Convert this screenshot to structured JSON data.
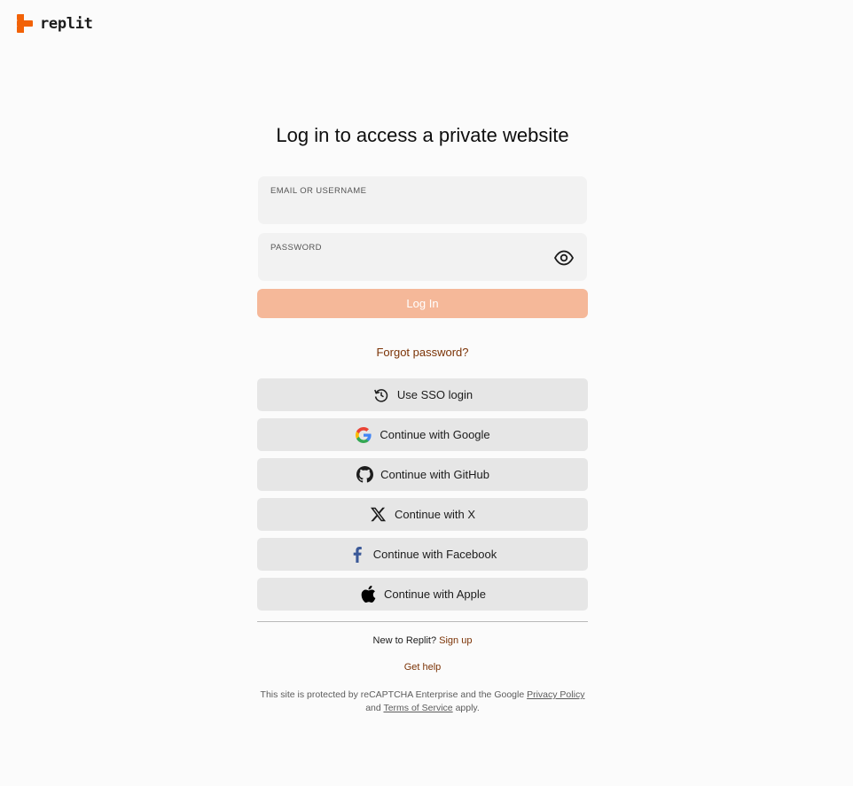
{
  "brand": {
    "wordmark": "replit",
    "color": "#f26207"
  },
  "page": {
    "title": "Log in to access a private website"
  },
  "form": {
    "username_label": "EMAIL OR USERNAME",
    "username_value": "",
    "password_label": "PASSWORD",
    "password_value": "",
    "password_toggle_icon": "eye-icon",
    "login_label": "Log In",
    "login_color": "#f5b899",
    "forgot_label": "Forgot password?"
  },
  "providers": [
    {
      "label": "Use SSO login",
      "icon": "sso-refresh-icon"
    },
    {
      "label": "Continue with Google",
      "icon": "google-icon"
    },
    {
      "label": "Continue with GitHub",
      "icon": "github-icon"
    },
    {
      "label": "Continue with X",
      "icon": "x-icon"
    },
    {
      "label": "Continue with Facebook",
      "icon": "facebook-icon"
    },
    {
      "label": "Continue with Apple",
      "icon": "apple-icon"
    }
  ],
  "footer": {
    "new_prefix": "New to Replit?",
    "signup_label": "Sign up",
    "help_label": "Get help",
    "legal_prefix": "This site is protected by reCAPTCHA Enterprise and the Google",
    "privacy_label": "Privacy Policy",
    "and_text": "and",
    "terms_label": "Terms of Service",
    "legal_suffix": "apply."
  },
  "colors": {
    "link": "#7b3306",
    "button_bg": "#e6e6e6",
    "field_bg": "#f2f2f2"
  }
}
